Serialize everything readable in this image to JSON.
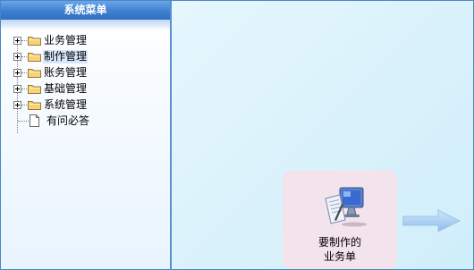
{
  "sidebar": {
    "title": "系统菜单",
    "items": [
      {
        "label": "业务管理",
        "icon": "folder-icon",
        "expandable": true,
        "selected": false
      },
      {
        "label": "制作管理",
        "icon": "folder-icon",
        "expandable": true,
        "selected": true
      },
      {
        "label": "账务管理",
        "icon": "folder-icon",
        "expandable": true,
        "selected": false
      },
      {
        "label": "基础管理",
        "icon": "folder-icon",
        "expandable": true,
        "selected": false
      },
      {
        "label": "系统管理",
        "icon": "folder-icon",
        "expandable": true,
        "selected": false
      },
      {
        "label": "有问必答",
        "icon": "document-icon",
        "expandable": false,
        "selected": false
      }
    ]
  },
  "main": {
    "task_card": {
      "line1": "要制作的",
      "line2": "业务单",
      "icon": "computer-document-icon"
    },
    "arrow_icon": "right-arrow-icon"
  },
  "colors": {
    "header_blue": "#3f7fcf",
    "panel_border": "#5b8fd0",
    "content_bg": "#ddf3fc",
    "card_bg": "#f3e3ec",
    "folder_yellow": "#f7d27a"
  }
}
